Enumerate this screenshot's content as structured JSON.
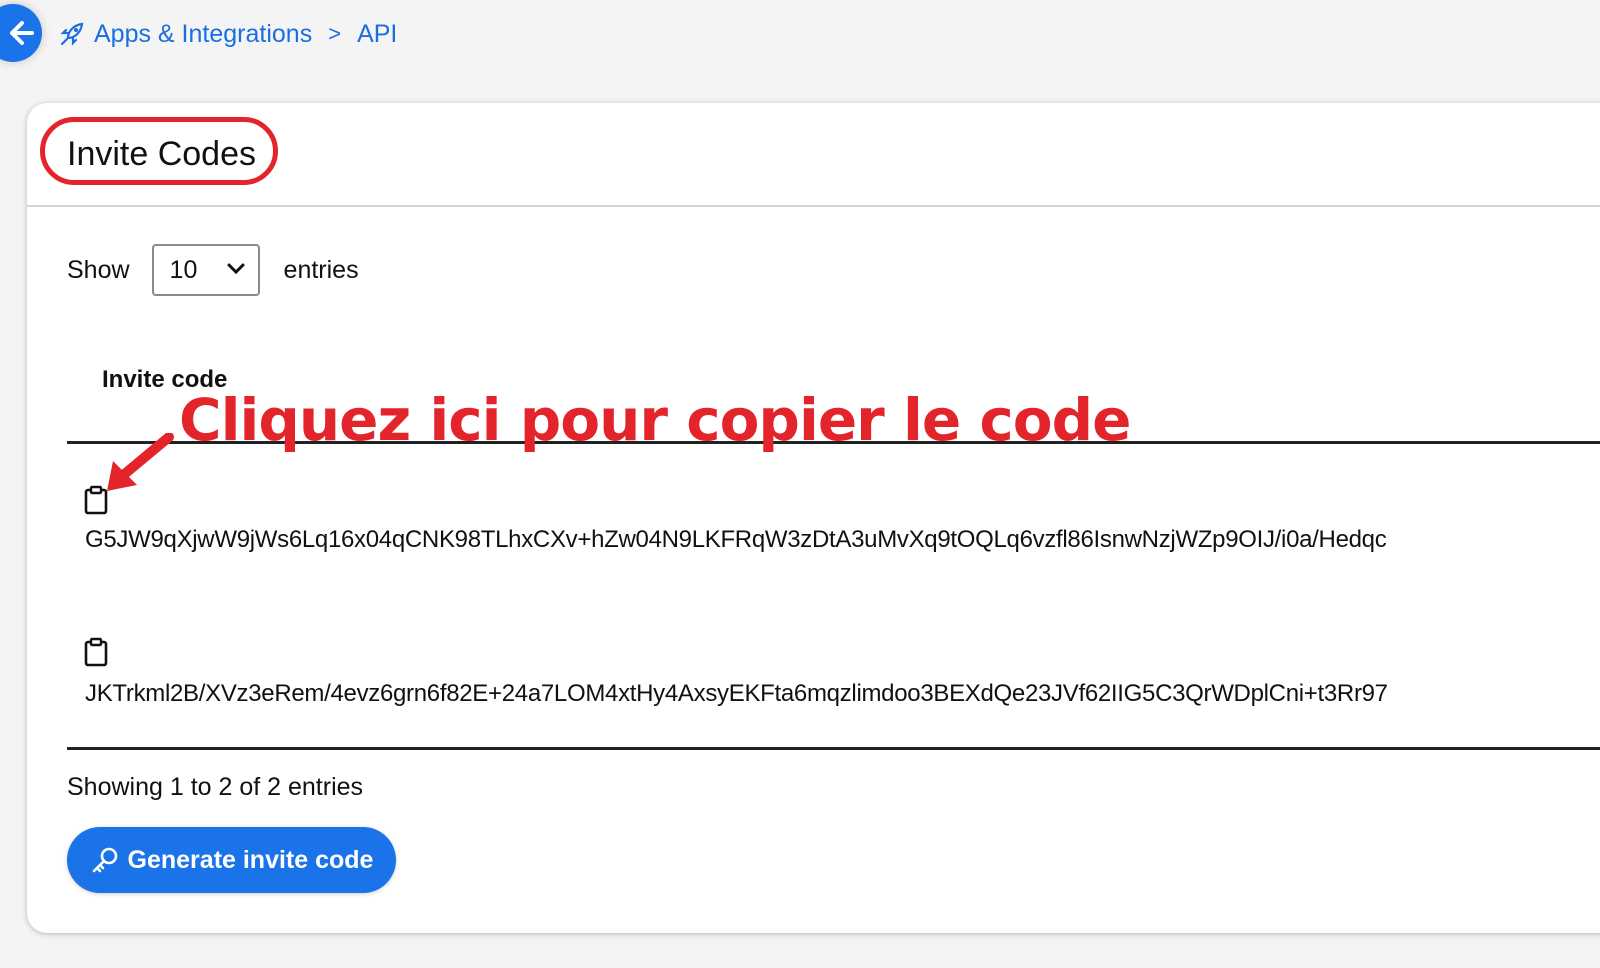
{
  "nav": {
    "back_icon": "arrow-left-icon",
    "breadcrumb_icon": "rocket-icon",
    "breadcrumb_parent": "Apps & Integrations",
    "breadcrumb_separator": ">",
    "breadcrumb_current": "API"
  },
  "card": {
    "title": "Invite Codes",
    "show_label": "Show",
    "page_size": "10",
    "entries_label": "entries",
    "column_header": "Invite code",
    "rows": [
      {
        "copy_icon": "clipboard-icon",
        "code": "G5JW9qXjwW9jWs6Lq16x04qCNK98TLhxCXv+hZw04N9LKFRqW3zDtA3uMvXq9tOQLq6vzfl86IsnwNzjWZp9OIJ/i0a/Hedqc"
      },
      {
        "copy_icon": "clipboard-icon",
        "code": "JKTrkml2B/XVz3eRem/4evz6grn6f82E+24a7LOM4xtHy4AxsyEKFta6mqzlimdoo3BEXdQe23JVf62IIG5C3QrWDplCni+t3Rr97"
      }
    ],
    "info": "Showing 1 to 2 of 2 entries",
    "generate_button": "Generate invite code",
    "generate_icon": "key-icon"
  },
  "annotation": {
    "text": "Cliquez ici pour copier le code",
    "color": "#e3242b"
  },
  "colors": {
    "accent": "#1a73e8",
    "annotation": "#e3242b"
  }
}
